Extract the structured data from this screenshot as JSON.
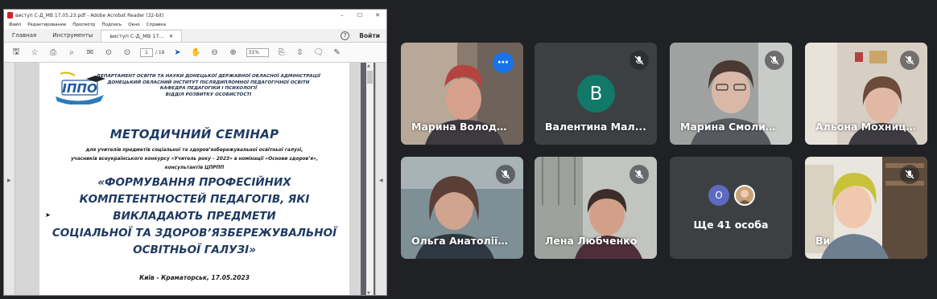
{
  "reader": {
    "window_title": "виступ С-Д_МВ 17.05.23.pdf - Adobe Acrobat Reader (32-bit)",
    "menu": [
      "Файл",
      "Редактирование",
      "Просмотр",
      "Подпись",
      "Окно",
      "Справка"
    ],
    "tabs": {
      "home": "Главная",
      "tools": "Инструменты",
      "doc": "виступ С-Д_МВ 17...",
      "login": "Войти"
    },
    "toolbar": {
      "page_current": "1",
      "page_total": "/ 16",
      "zoom": "31%"
    },
    "document": {
      "logo_text": "ІППО",
      "org_lines": [
        "ДЕПАРТАМЕНТ ОСВІТИ ТА НАУКИ ДОНЕЦЬКОЇ ДЕРЖАВНОЇ ОБЛАСНОЇ АДМІНІСТРАЦІЇ",
        "ДОНЕЦЬКИЙ ОБЛАСНИЙ ІНСТИТУТ ПІСЛЯДИПЛОМНОЇ ПЕДАГОГІЧНОЇ ОСВІТИ",
        "КАФЕДРА ПЕДАГОГІКИ І ПСИХОЛОГІЇ",
        "ВІДДІЛ РОЗВИТКУ ОСОБИСТОСТІ"
      ],
      "title": "МЕТОДИЧНИЙ СЕМІНАР",
      "subtitle_lines": [
        "для учителів предметів соціальної та здоров’язбережувальної освітньої галузі,",
        "учасників всеукраїнського конкурсу «Учитель року – 2023» в номінації «Основи здоров’я»,",
        "консультантів ЦПРПП"
      ],
      "topic_lines": [
        "«ФОРМУВАННЯ ПРОФЕСІЙНИХ",
        "КОМПЕТЕНТНОСТЕЙ ПЕДАГОГІВ, ЯКІ",
        "ВИКЛАДАЮТЬ ПРЕДМЕТИ",
        "СОЦІАЛЬНОЇ ТА ЗДОРОВ’ЯЗБЕРЕЖУВАЛЬНОЇ",
        "ОСВІТНЬОЇ ГАЛУЗІ»"
      ],
      "place_date": "Київ - Краматорськ, 17.05.2023"
    }
  },
  "participants": [
    {
      "name": "Марина Володи...",
      "speaking": true
    },
    {
      "name": "Валентина Мал...",
      "avatar_letter": "В",
      "avatar_color": "#127868"
    },
    {
      "name": "Марина Смолин..."
    },
    {
      "name": "Альона Мохниц..."
    },
    {
      "name": "Ольга Анатоліїв..."
    },
    {
      "name": "Лена Любченко"
    },
    {
      "name": "Ще 41 особа",
      "avatar_letter": "О"
    },
    {
      "name": "Ви"
    }
  ],
  "colors": {
    "meet_bg": "#202124",
    "speaking_outline": "#8ab4f8",
    "more_button": "#1a73e8",
    "doc_title": "#1f3a63"
  }
}
